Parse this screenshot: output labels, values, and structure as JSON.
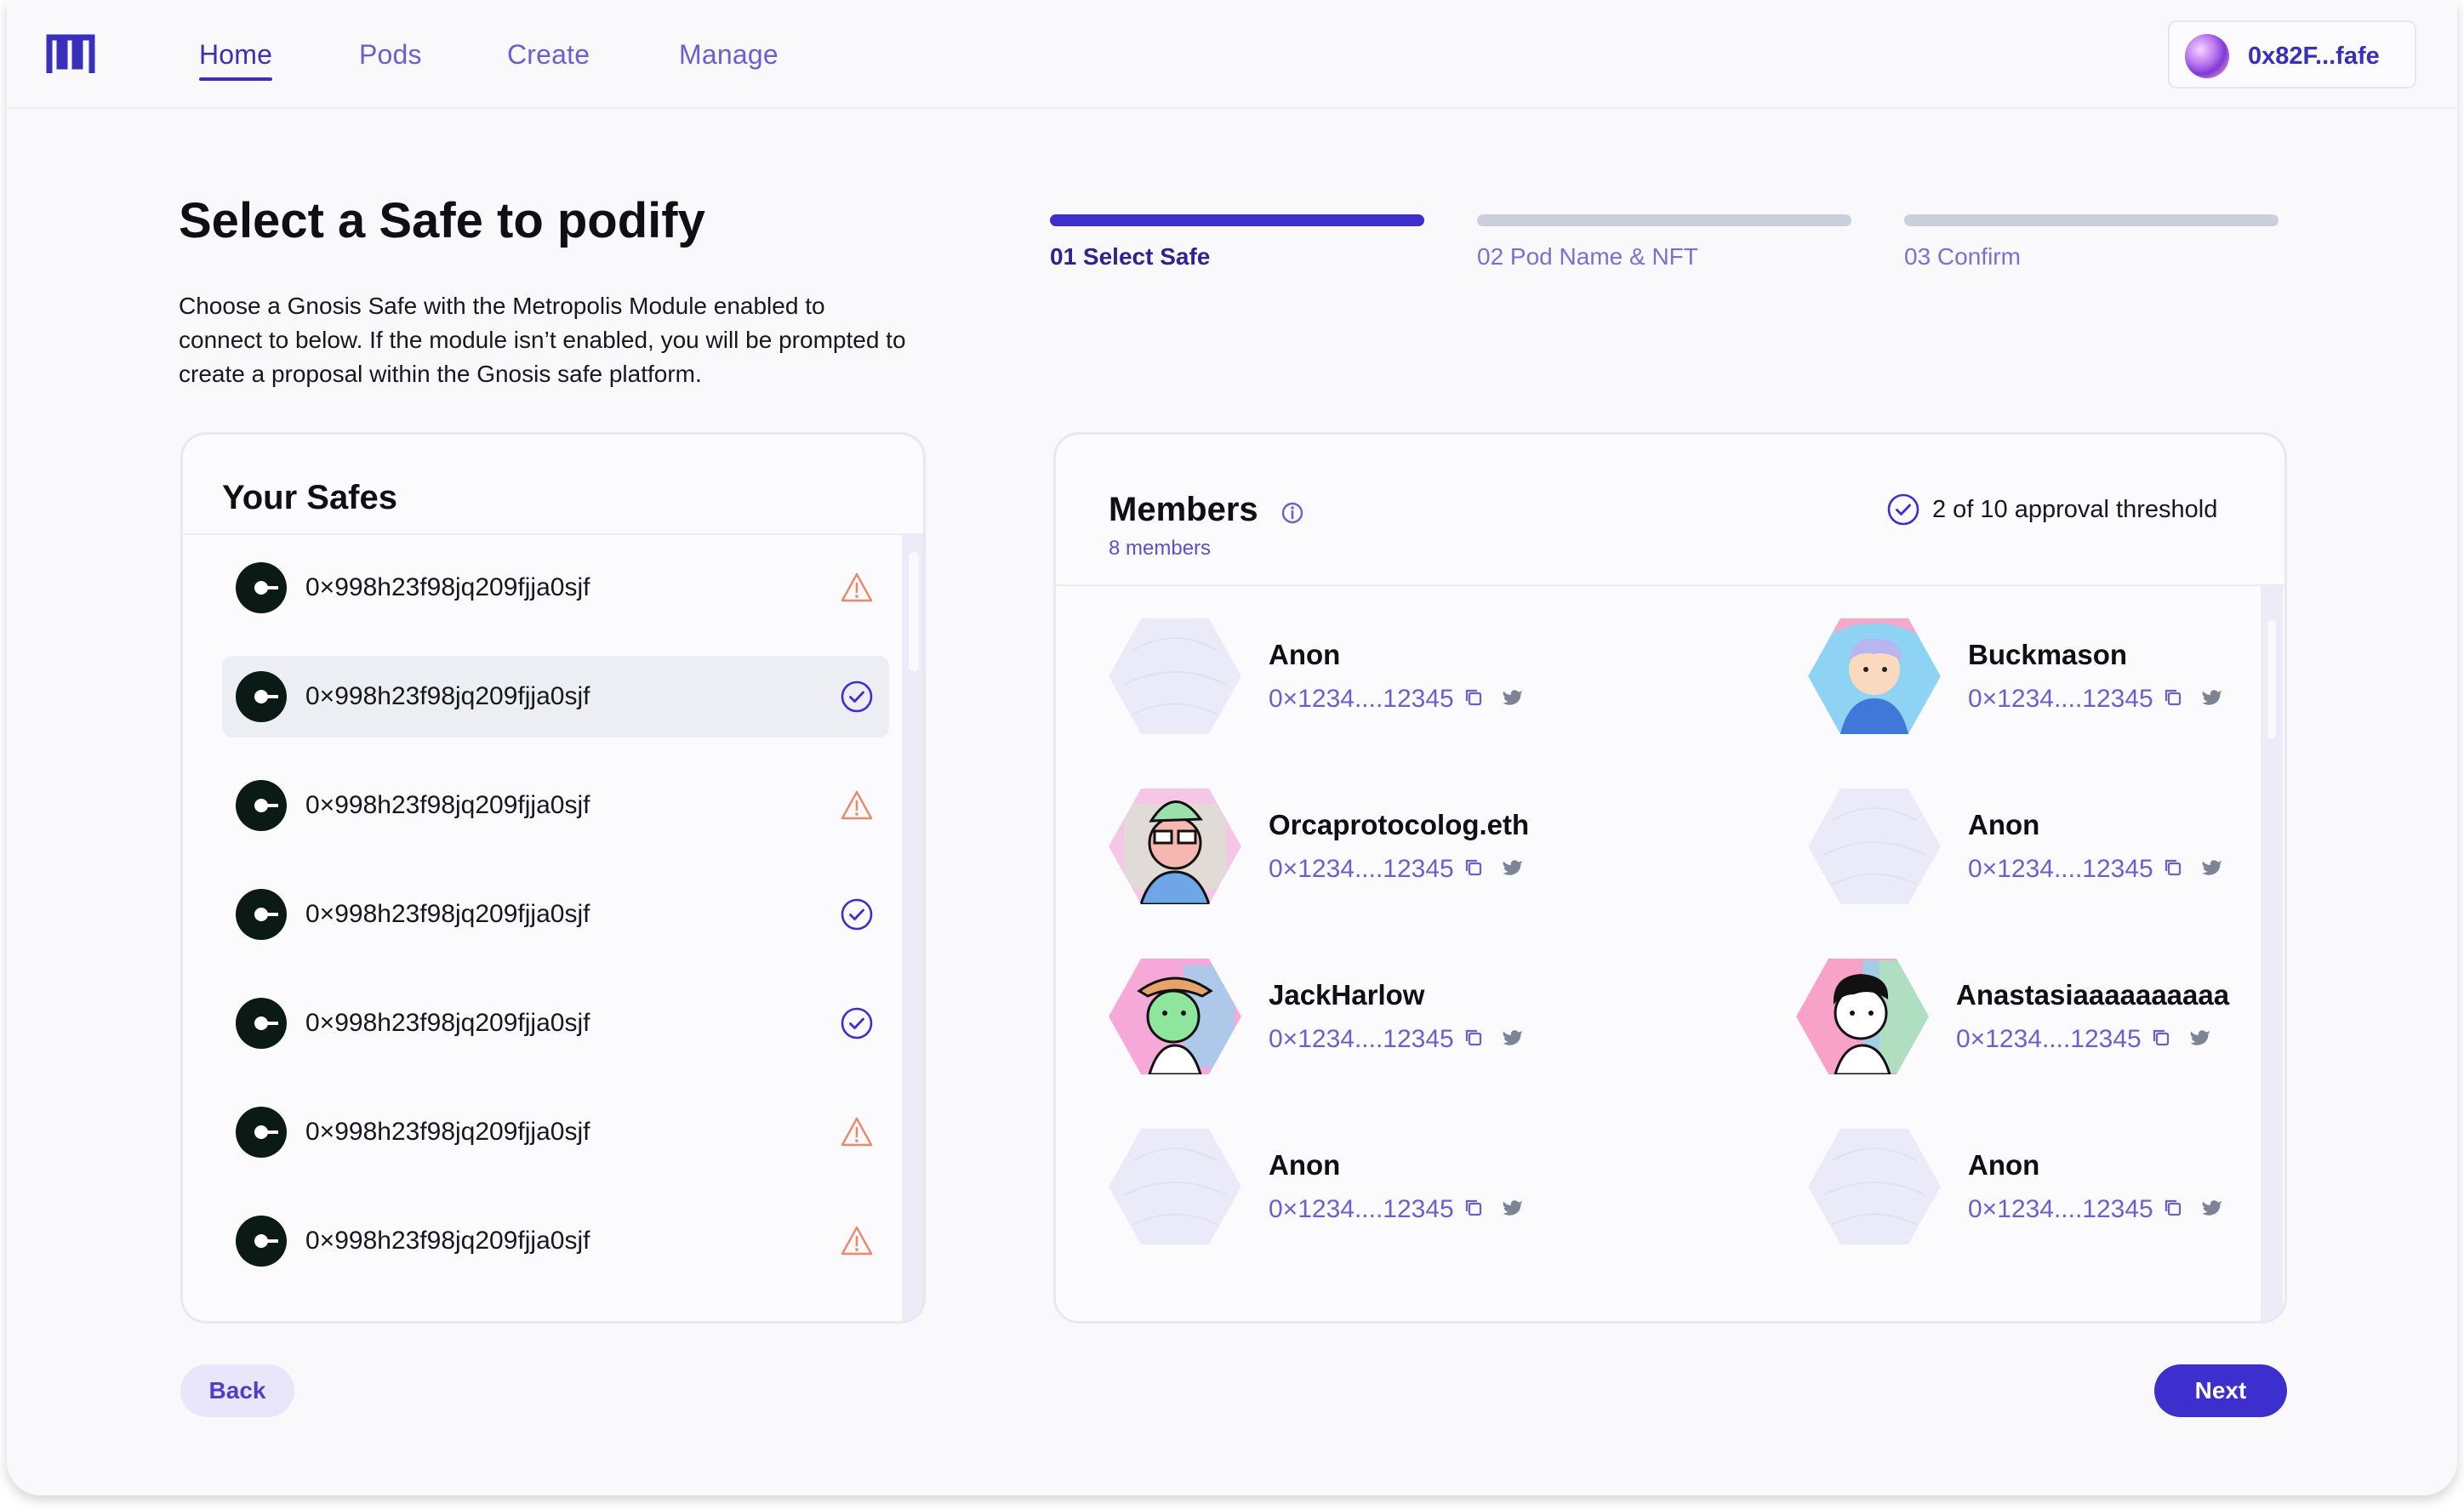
{
  "nav": {
    "links": [
      {
        "label": "Home",
        "active": true
      },
      {
        "label": "Pods",
        "active": false
      },
      {
        "label": "Create",
        "active": false
      },
      {
        "label": "Manage",
        "active": false
      }
    ],
    "wallet_address": "0x82F...fafe"
  },
  "header": {
    "title": "Select a Safe to podify",
    "description": "Choose a Gnosis Safe with the Metropolis Module enabled to connect to below. If the module isn’t enabled, you will be prompted to create a proposal within the Gnosis safe platform."
  },
  "steps": [
    {
      "label": "01 Select Safe",
      "active": true
    },
    {
      "label": "02 Pod Name & NFT",
      "active": false
    },
    {
      "label": "03 Confirm",
      "active": false
    }
  ],
  "safes": {
    "title": "Your Safes",
    "items": [
      {
        "address": "0×998h23f98jq209fjja0sjf",
        "status": "warning-icon",
        "selected": false
      },
      {
        "address": "0×998h23f98jq209fjja0sjf",
        "status": "check-circle-icon",
        "selected": true
      },
      {
        "address": "0×998h23f98jq209fjja0sjf",
        "status": "warning-icon",
        "selected": false
      },
      {
        "address": "0×998h23f98jq209fjja0sjf",
        "status": "check-circle-icon",
        "selected": false
      },
      {
        "address": "0×998h23f98jq209fjja0sjf",
        "status": "check-circle-icon",
        "selected": false
      },
      {
        "address": "0×998h23f98jq209fjja0sjf",
        "status": "warning-icon",
        "selected": false
      },
      {
        "address": "0×998h23f98jq209fjja0sjf",
        "status": "warning-icon",
        "selected": false
      }
    ]
  },
  "members": {
    "title": "Members",
    "count_label": "8 members",
    "threshold": "2 of 10 approval threshold",
    "items": [
      {
        "name": "Anon",
        "address": "0×1234....12345",
        "avatar": "placeholder"
      },
      {
        "name": "Buckmason",
        "address": "0×1234....12345",
        "avatar": "buckmason"
      },
      {
        "name": "Orcaprotocolog.eth",
        "address": "0×1234....12345",
        "avatar": "orca"
      },
      {
        "name": "Anon",
        "address": "0×1234....12345",
        "avatar": "placeholder"
      },
      {
        "name": "JackHarlow",
        "address": "0×1234....12345",
        "avatar": "jack"
      },
      {
        "name": "Anastasiaaaaaaaaaa",
        "address": "0×1234....12345",
        "avatar": "anastasia"
      },
      {
        "name": "Anon",
        "address": "0×1234....12345",
        "avatar": "placeholder"
      },
      {
        "name": "Anon",
        "address": "0×1234....12345",
        "avatar": "placeholder"
      }
    ]
  },
  "actions": {
    "back_label": "Back",
    "next_label": "Next"
  },
  "colors": {
    "accent": "#3d2fcd",
    "warning": "#f0866a",
    "link": "#6a5fd1"
  }
}
